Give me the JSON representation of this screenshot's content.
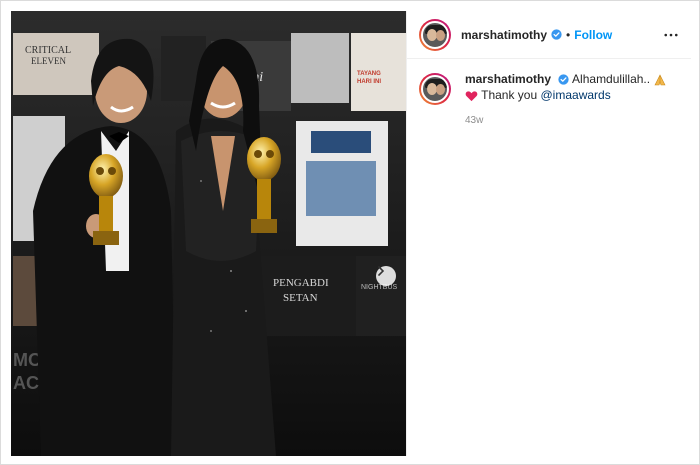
{
  "post": {
    "username": "marshatimothy",
    "follow_label": "Follow",
    "separator": "•",
    "caption": {
      "line1_text": "Alhamdulillah..",
      "line1_emoji": "folded-hands-icon",
      "line2_emoji": "red-heart-icon",
      "line2_text": "Thank you ",
      "mention": "@imaawards"
    },
    "time_ago": "43w"
  },
  "photo": {
    "signage": [
      "CRITICAL",
      "ELEVEN",
      "rtini",
      "TAYANG",
      "HARI INI",
      "PENGABDI",
      "SETAN",
      "NIGHTBUS",
      "MOV",
      "ACTO"
    ]
  },
  "colors": {
    "accent": "#0095f6",
    "verified": "#3897f0",
    "mention": "#00376b",
    "muted": "#8e8e8e"
  },
  "icons": [
    "verified-badge-icon",
    "more-options-icon",
    "carousel-next-icon",
    "red-heart-icon",
    "folded-hands-icon"
  ]
}
